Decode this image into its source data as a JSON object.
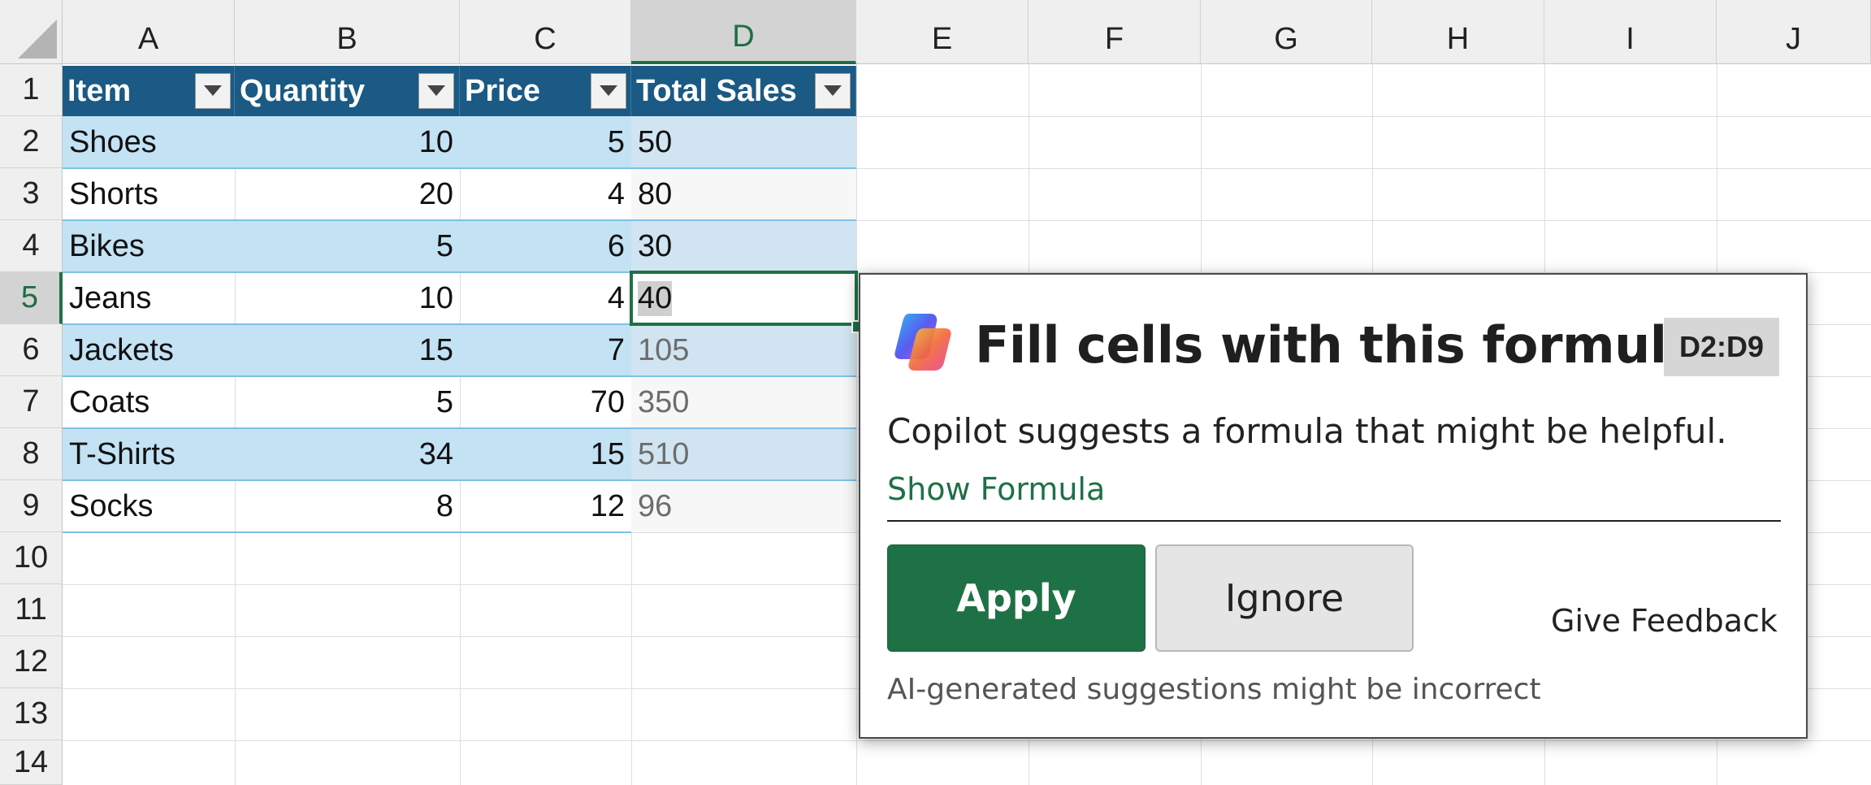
{
  "columns": [
    "A",
    "B",
    "C",
    "D",
    "E",
    "F",
    "G",
    "H",
    "I",
    "J"
  ],
  "rows": [
    "1",
    "2",
    "3",
    "4",
    "5",
    "6",
    "7",
    "8",
    "9",
    "10",
    "11",
    "12",
    "13",
    "14"
  ],
  "table": {
    "headers": [
      "Item",
      "Quantity",
      "Price",
      "Total Sales"
    ],
    "rows": [
      {
        "item": "Shoes",
        "qty": "10",
        "price": "5",
        "total": "50"
      },
      {
        "item": "Shorts",
        "qty": "20",
        "price": "4",
        "total": "80"
      },
      {
        "item": "Bikes",
        "qty": "5",
        "price": "6",
        "total": "30"
      },
      {
        "item": "Jeans",
        "qty": "10",
        "price": "4",
        "total": "40"
      },
      {
        "item": "Jackets",
        "qty": "15",
        "price": "7",
        "total": "105"
      },
      {
        "item": "Coats",
        "qty": "5",
        "price": "70",
        "total": "350"
      },
      {
        "item": "T-Shirts",
        "qty": "34",
        "price": "15",
        "total": "510"
      },
      {
        "item": "Socks",
        "qty": "8",
        "price": "12",
        "total": "96"
      }
    ]
  },
  "popup": {
    "title": "Fill cells with this formula?",
    "range": "D2:D9",
    "description": "Copilot suggests a formula that might be helpful.",
    "show_formula": "Show Formula",
    "apply": "Apply",
    "ignore": "Ignore",
    "feedback": "Give Feedback",
    "disclaimer": "AI-generated suggestions might be incorrect"
  },
  "colors": {
    "header_fill": "#1a5a84",
    "band_fill": "#c3e2f4",
    "accent_green": "#1e7145"
  }
}
